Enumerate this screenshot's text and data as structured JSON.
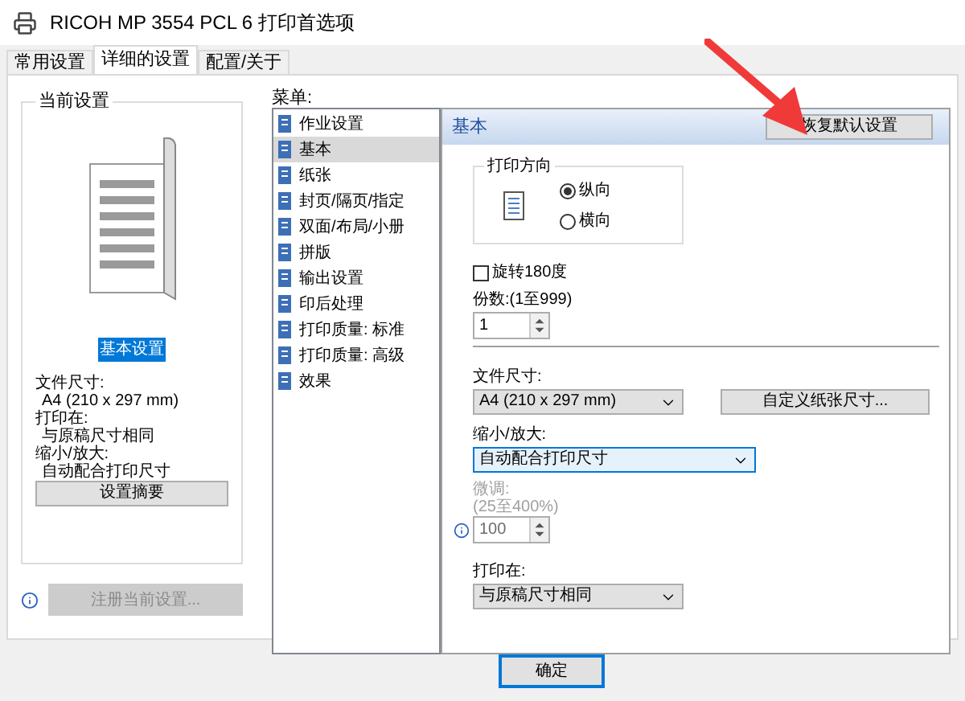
{
  "window": {
    "title": "RICOH MP 3554 PCL 6 打印首选项"
  },
  "tabs": [
    {
      "label": "常用设置",
      "selected": false
    },
    {
      "label": "详细的设置",
      "selected": true
    },
    {
      "label": "配置/关于",
      "selected": false
    }
  ],
  "current_settings": {
    "title": "当前设置",
    "preset": "基本设置",
    "details": [
      {
        "label": "文件尺寸:",
        "value": "A4 (210 x 297 mm)"
      },
      {
        "label": "打印在:",
        "value": "与原稿尺寸相同"
      },
      {
        "label": "缩小/放大:",
        "value": "自动配合打印尺寸"
      }
    ],
    "summary_button": "设置摘要",
    "register_button": {
      "label": "注册当前设置...",
      "disabled": true
    }
  },
  "menu": {
    "label": "菜单:",
    "items": [
      {
        "label": "作业设置",
        "selected": false
      },
      {
        "label": "基本",
        "selected": true
      },
      {
        "label": "纸张",
        "selected": false
      },
      {
        "label": "封页/隔页/指定",
        "selected": false
      },
      {
        "label": "双面/布局/小册",
        "selected": false
      },
      {
        "label": "拼版",
        "selected": false
      },
      {
        "label": "输出设置",
        "selected": false
      },
      {
        "label": "印后处理",
        "selected": false
      },
      {
        "label": "打印质量: 标准",
        "selected": false
      },
      {
        "label": "打印质量: 高级",
        "selected": false
      },
      {
        "label": "效果",
        "selected": false
      }
    ]
  },
  "panel": {
    "title": "基本",
    "reset_button": "恢复默认设置",
    "orientation": {
      "title": "打印方向",
      "options": [
        {
          "label": "纵向",
          "selected": true
        },
        {
          "label": "横向",
          "selected": false
        }
      ]
    },
    "rotate": {
      "label": "旋转180度",
      "checked": false
    },
    "copies": {
      "label": "份数:(1至999)",
      "value": "1"
    },
    "paper_size": {
      "label": "文件尺寸:",
      "value": "A4 (210 x 297 mm)"
    },
    "custom_size_button": "自定义纸张尺寸...",
    "zoom": {
      "label": "缩小/放大:",
      "value": "自动配合打印尺寸"
    },
    "fine_tune": {
      "label": "微调:",
      "range": "(25至400%)",
      "value": "100",
      "disabled": true
    },
    "print_on": {
      "label": "打印在:",
      "value": "与原稿尺寸相同"
    }
  },
  "buttons": [
    {
      "label": "确定"
    }
  ]
}
